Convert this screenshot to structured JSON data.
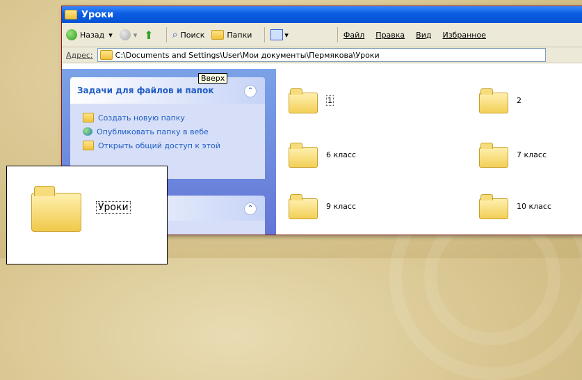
{
  "window": {
    "title": "Уроки"
  },
  "toolbar": {
    "back_label": "Назад",
    "search_label": "Поиск",
    "folders_label": "Папки",
    "menu": [
      "Файл",
      "Правка",
      "Вид",
      "Избранное"
    ]
  },
  "address": {
    "label": "Адрес:",
    "path": "C:\\Documents and Settings\\User\\Мои документы\\Пермякова\\Уроки"
  },
  "tooltip": "Вверх",
  "sidebar": {
    "panel_title": "Задачи для файлов и папок",
    "tasks": [
      "Создать новую папку",
      "Опубликовать папку в вебе",
      "Открыть общий доступ к этой"
    ]
  },
  "folders": [
    "1",
    "2",
    "6 класс",
    "7 класс",
    "9 класс",
    "10 класс"
  ],
  "callout": {
    "label": "Уроки"
  }
}
